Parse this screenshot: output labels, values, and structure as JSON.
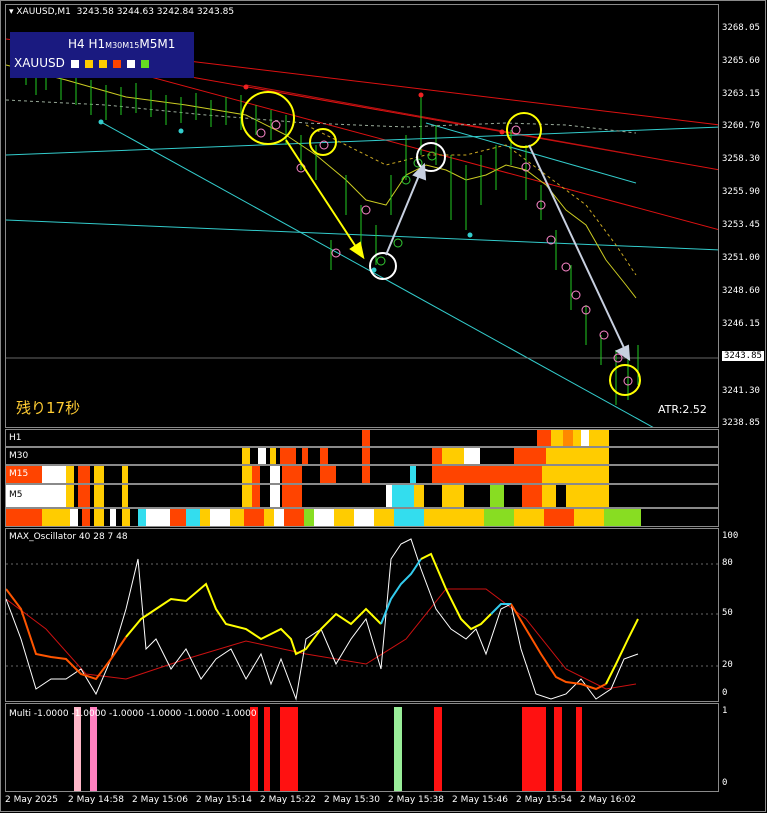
{
  "chart_header": {
    "symbol_tf": "XAUUSD,M1",
    "ohlc": "3243.58 3244.63 3242.84 3243.85"
  },
  "mtf_panel": {
    "tf_h4": "H4",
    "tf_h1": "H1",
    "tf_m30": "M30",
    "tf_m15": "M15",
    "tf_m5": "M5",
    "tf_m1": "M1",
    "symbol": "XAUUSD",
    "colors": [
      "#ffffff",
      "#ffcc00",
      "#ffcc00",
      "#ff4400",
      "#ffffff",
      "#66dd22"
    ]
  },
  "countdown": "残り17秒",
  "atr": "ATR:2.52",
  "price_axis": [
    "3268.05",
    "3265.60",
    "3263.15",
    "3260.70",
    "3258.30",
    "3255.90",
    "3253.45",
    "3251.00",
    "3248.60",
    "3246.15",
    "3243.85",
    "3241.30",
    "3238.85"
  ],
  "current_price": "3243.85",
  "sub_bars": {
    "h1_label": "H1",
    "m30_label": "M30",
    "m15_label": "M15",
    "m5_label": "M5"
  },
  "oscillator": {
    "title": "MAX_Oscillator 40 28 7 48",
    "axis": [
      "100",
      "80",
      "50",
      "20",
      "0"
    ]
  },
  "multi": {
    "title": "Multi -1.0000 -1.0000 -1.0000 -1.0000 -1.0000 -1.0000",
    "axis": [
      "1",
      "0"
    ]
  },
  "time_axis": [
    "2 May 2025",
    "2 May 14:58",
    "2 May 15:06",
    "2 May 15:14",
    "2 May 15:22",
    "2 May 15:30",
    "2 May 15:38",
    "2 May 15:46",
    "2 May 15:54",
    "2 May 16:02"
  ],
  "colors": {
    "bg": "#000000",
    "candle": "#22cc22",
    "trend_red": "#dd1111",
    "trend_cyan": "#33cccc",
    "circle_yellow": "#ffff00",
    "arrow_white": "#c8d0e0",
    "osc_white": "#ffffff",
    "osc_yellow": "#ffff00",
    "osc_orange": "#ff5500",
    "osc_cyan": "#33ccee",
    "osc_red": "#cc1111"
  }
}
